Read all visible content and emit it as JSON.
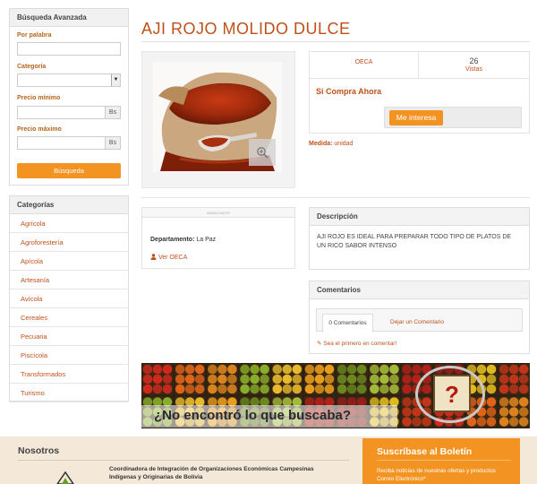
{
  "search": {
    "title": "Búsqueda Avanzada",
    "word_label": "Por palabra",
    "category_label": "Categoría",
    "min_price_label": "Precio mínimo",
    "max_price_label": "Precio máximo",
    "currency": "Bs",
    "button": "Búsqueda"
  },
  "categories": {
    "title": "Categorías",
    "items": [
      "Agrícola",
      "Agroforestería",
      "Apícola",
      "Artesanía",
      "Avícola",
      "Cereales",
      "Pecuaria",
      "Piscícola",
      "Transformados",
      "Turismo"
    ]
  },
  "product": {
    "title": "AJI ROJO MOLIDO DULCE",
    "seller": "OECA",
    "views_count": "26",
    "views_label": "Vistas",
    "buy_heading": "Si Compra Ahora",
    "interest_button": "Me interesa",
    "measure_label": "Medida:",
    "measure_value": "unidad"
  },
  "seller_box": {
    "header": "ANUNCIANTE",
    "department_label": "Departamento:",
    "department_value": "La Paz",
    "link": "Ver OECA"
  },
  "description": {
    "title": "Descripción",
    "text": "AJI ROJO ES IDEAL PARA PREPARAR TODO TIPO DE PLATOS DE UN RICO SABOR INTENSO"
  },
  "comments": {
    "title": "Comentarios",
    "tab_count": "0 Comentarios",
    "tab_leave": "Dejar un Comentario",
    "first": "Sea el primero en comentar!"
  },
  "banner": {
    "text": "¿No encontró lo que buscaba?",
    "question": "?"
  },
  "footer": {
    "about_title": "Nosotros",
    "org_name": "Coordinadora de Integración de Organizaciones Económicas Campesinas Indígenas y Originarias de Bolivia",
    "newsletter_title": "Suscríbase al Boletín",
    "newsletter_text": "Reciba noticias de nuestras ofertas y productos",
    "email_label": "Correo Electrónico*"
  },
  "colors": {
    "accent": "#f39322",
    "title": "#c0501a",
    "footer_bg": "#f4e9d9",
    "newsletter_bg": "#f39322"
  }
}
